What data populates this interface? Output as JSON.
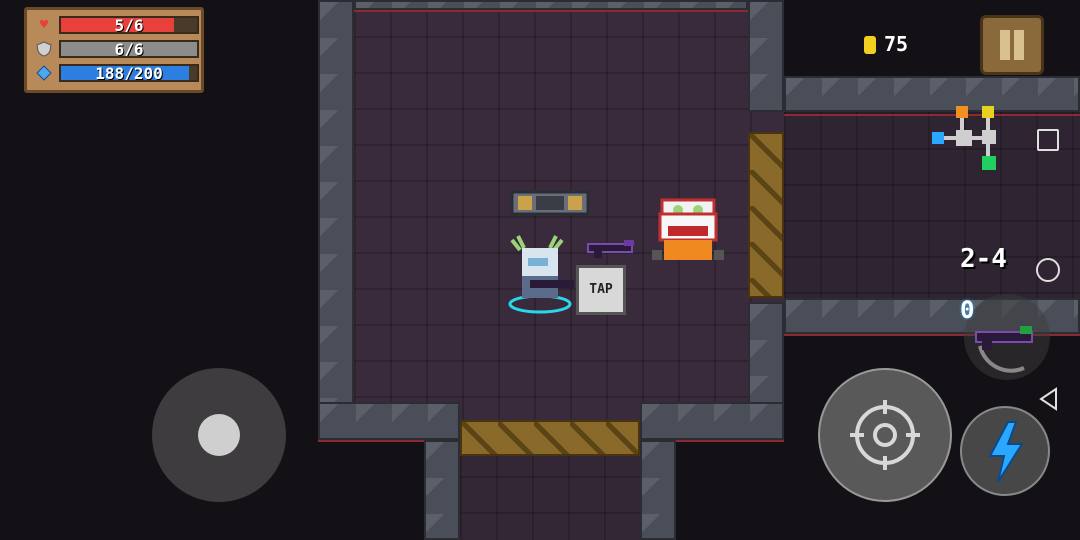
{
  "hud": {
    "health": {
      "text": "5/6",
      "value": 5,
      "max": 6,
      "color": "#e8403a"
    },
    "armor": {
      "text": "6/6",
      "value": 6,
      "max": 6,
      "color": "#8c8c8c"
    },
    "energy": {
      "text": "188/200",
      "value": 188,
      "max": 200,
      "color": "#2c7fe0"
    },
    "coins": "75",
    "level": "2-4",
    "weapon_energy_cost": "0",
    "tap_prompt": "TAP"
  },
  "colors": {
    "health": "#e8403a",
    "armor": "#8c8c8c",
    "energy": "#2c7fe0",
    "coin": "#f2d020",
    "skill": "#2aa8ff"
  },
  "icons": {
    "health": "heart-icon",
    "armor": "shield-icon",
    "energy": "diamond-icon",
    "coin": "coin-icon",
    "pause": "pause-icon",
    "attack": "crosshair-icon",
    "skill": "lightning-icon",
    "weapon": "gun-icon"
  }
}
